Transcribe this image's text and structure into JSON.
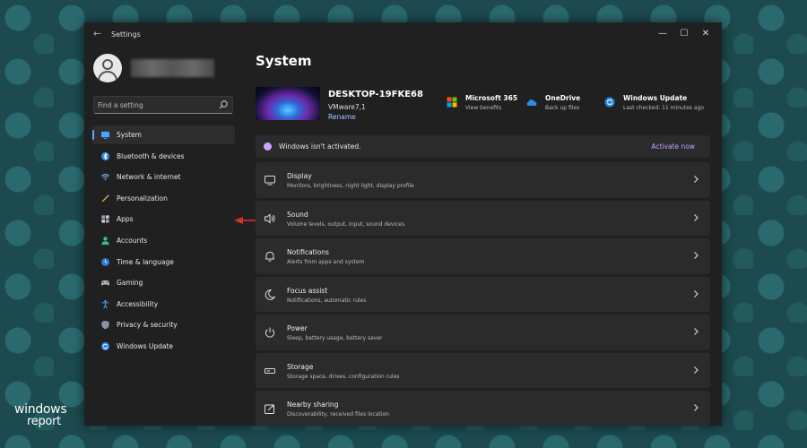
{
  "window": {
    "title": "Settings"
  },
  "search": {
    "placeholder": "Find a setting"
  },
  "sidebar": {
    "items": [
      {
        "label": "System",
        "icon": "monitor-icon",
        "active": true
      },
      {
        "label": "Bluetooth & devices",
        "icon": "bluetooth-icon"
      },
      {
        "label": "Network & internet",
        "icon": "wifi-icon"
      },
      {
        "label": "Personalization",
        "icon": "brush-icon"
      },
      {
        "label": "Apps",
        "icon": "apps-icon"
      },
      {
        "label": "Accounts",
        "icon": "person-icon"
      },
      {
        "label": "Time & language",
        "icon": "globe-clock-icon"
      },
      {
        "label": "Gaming",
        "icon": "gamepad-icon"
      },
      {
        "label": "Accessibility",
        "icon": "accessibility-icon"
      },
      {
        "label": "Privacy & security",
        "icon": "shield-icon"
      },
      {
        "label": "Windows Update",
        "icon": "update-icon"
      }
    ]
  },
  "main": {
    "title": "System",
    "device": {
      "name": "DESKTOP-19FKE68",
      "model": "VMware7,1",
      "rename": "Rename"
    },
    "quick": [
      {
        "title": "Microsoft 365",
        "sub": "View benefits",
        "icon": "microsoft-logo-icon"
      },
      {
        "title": "OneDrive",
        "sub": "Back up files",
        "icon": "cloud-icon"
      },
      {
        "title": "Windows Update",
        "sub": "Last checked: 11 minutes ago",
        "icon": "update-icon"
      }
    ],
    "activation": {
      "text": "Windows isn't activated.",
      "action": "Activate now"
    },
    "settings": [
      {
        "title": "Display",
        "sub": "Monitors, brightness, night light, display profile",
        "icon": "display-icon"
      },
      {
        "title": "Sound",
        "sub": "Volume levels, output, input, sound devices",
        "icon": "speaker-icon"
      },
      {
        "title": "Notifications",
        "sub": "Alerts from apps and system",
        "icon": "bell-icon"
      },
      {
        "title": "Focus assist",
        "sub": "Notifications, automatic rules",
        "icon": "moon-icon"
      },
      {
        "title": "Power",
        "sub": "Sleep, battery usage, battery saver",
        "icon": "power-icon"
      },
      {
        "title": "Storage",
        "sub": "Storage space, drives, configuration rules",
        "icon": "storage-icon"
      },
      {
        "title": "Nearby sharing",
        "sub": "Discoverability, received files location",
        "icon": "share-icon"
      }
    ]
  },
  "watermark": {
    "line1": "windows",
    "line2": "report"
  },
  "colors": {
    "accent": "#5aaaff",
    "activation": "#c7a4ff",
    "annotation_arrow": "#d9322b"
  }
}
